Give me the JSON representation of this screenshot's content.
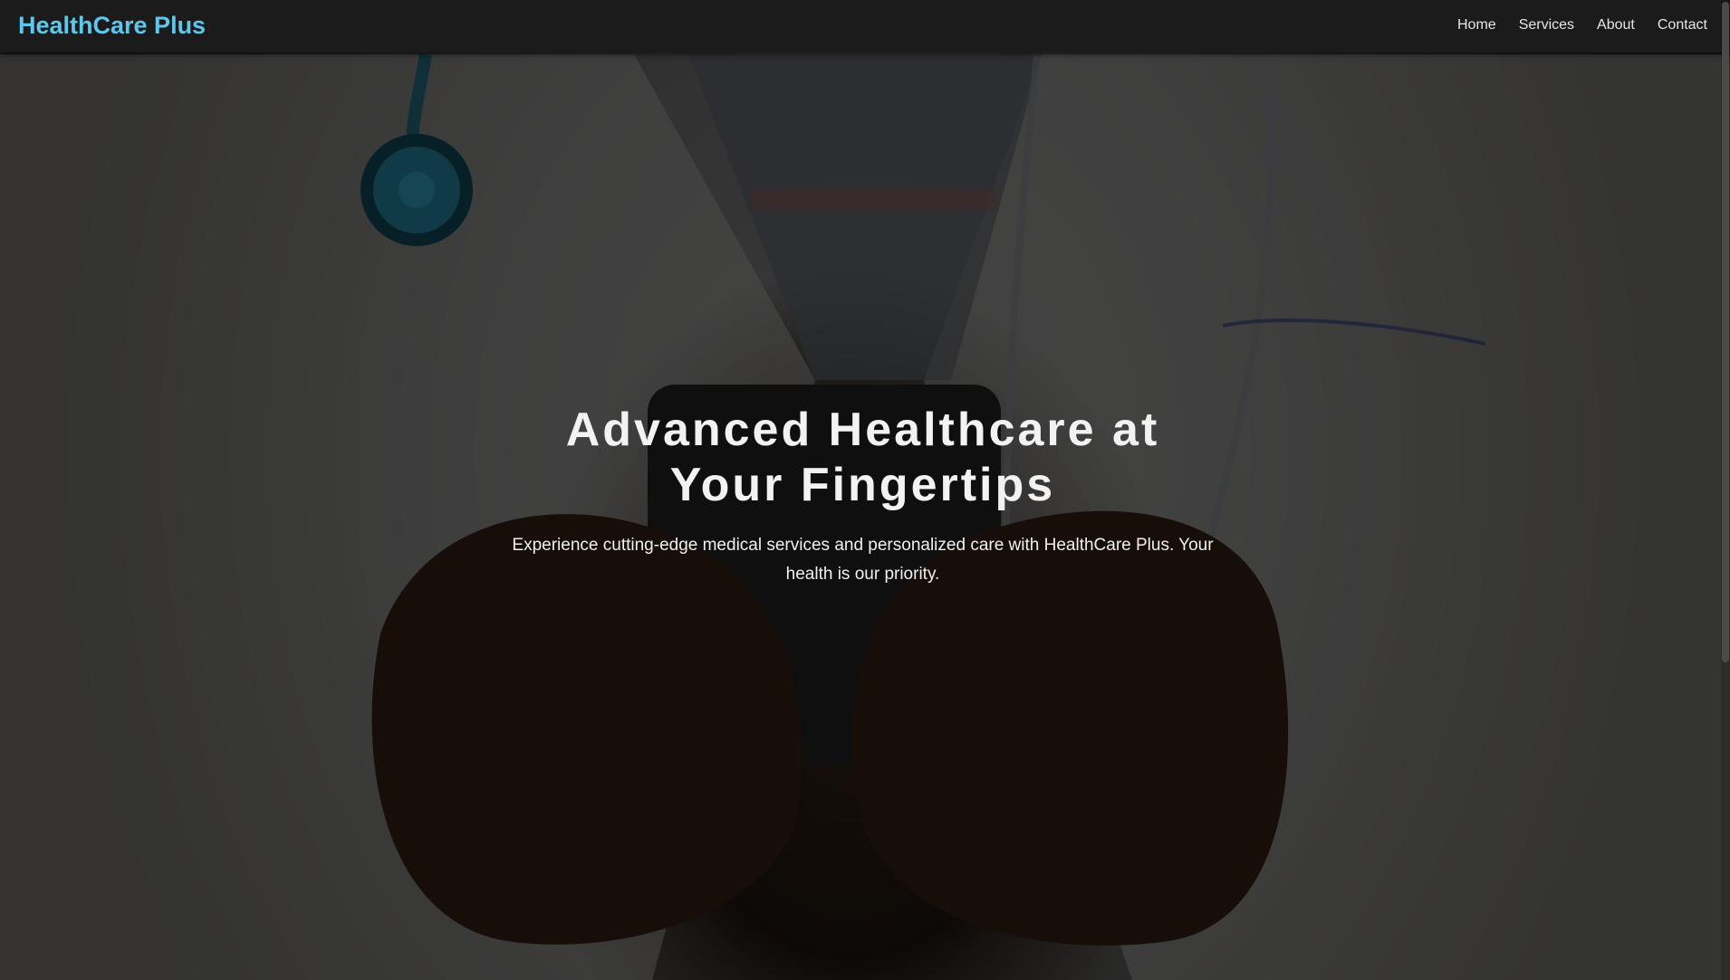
{
  "navbar": {
    "brand": "HealthCare Plus",
    "links": [
      "Home",
      "Services",
      "About",
      "Contact"
    ]
  },
  "hero": {
    "title": "Advanced Healthcare at Your Fingertips",
    "subtitle": "Experience cutting-edge medical services and personalized care with HealthCare Plus. Your health is our priority.",
    "background_image": "doctor-holding-phone-photo"
  },
  "colors": {
    "brand": "#5fc6ec",
    "navbar_bg": "#1b1b1b",
    "nav_text": "#e6e6e6",
    "hero_text": "#f2f2f2"
  }
}
